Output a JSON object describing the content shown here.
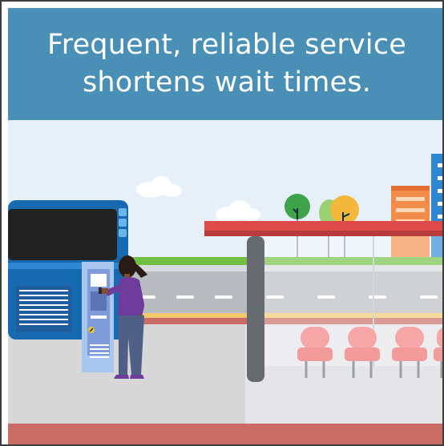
{
  "headline": "Frequent, reliable service shortens wait times.",
  "scene": {
    "elements": [
      "bus",
      "ticket-machine",
      "passenger",
      "bus-shelter",
      "bench-seats",
      "street",
      "trees",
      "buildings",
      "clouds"
    ]
  },
  "colors": {
    "headline_band": "#4a8fb6",
    "sky": "#e7f0f8",
    "bus_body": "#1769b0",
    "shelter_roof": "#de4a4a",
    "sidewalk_stripe": "#c96c66",
    "road": "#b8bcc1",
    "ticket_machine": "#a9c7ee",
    "passenger_top": "#6e3c9b",
    "passenger_pants": "#4f5f86",
    "seat": "#f6a6a6",
    "grass": "#73bf44"
  }
}
